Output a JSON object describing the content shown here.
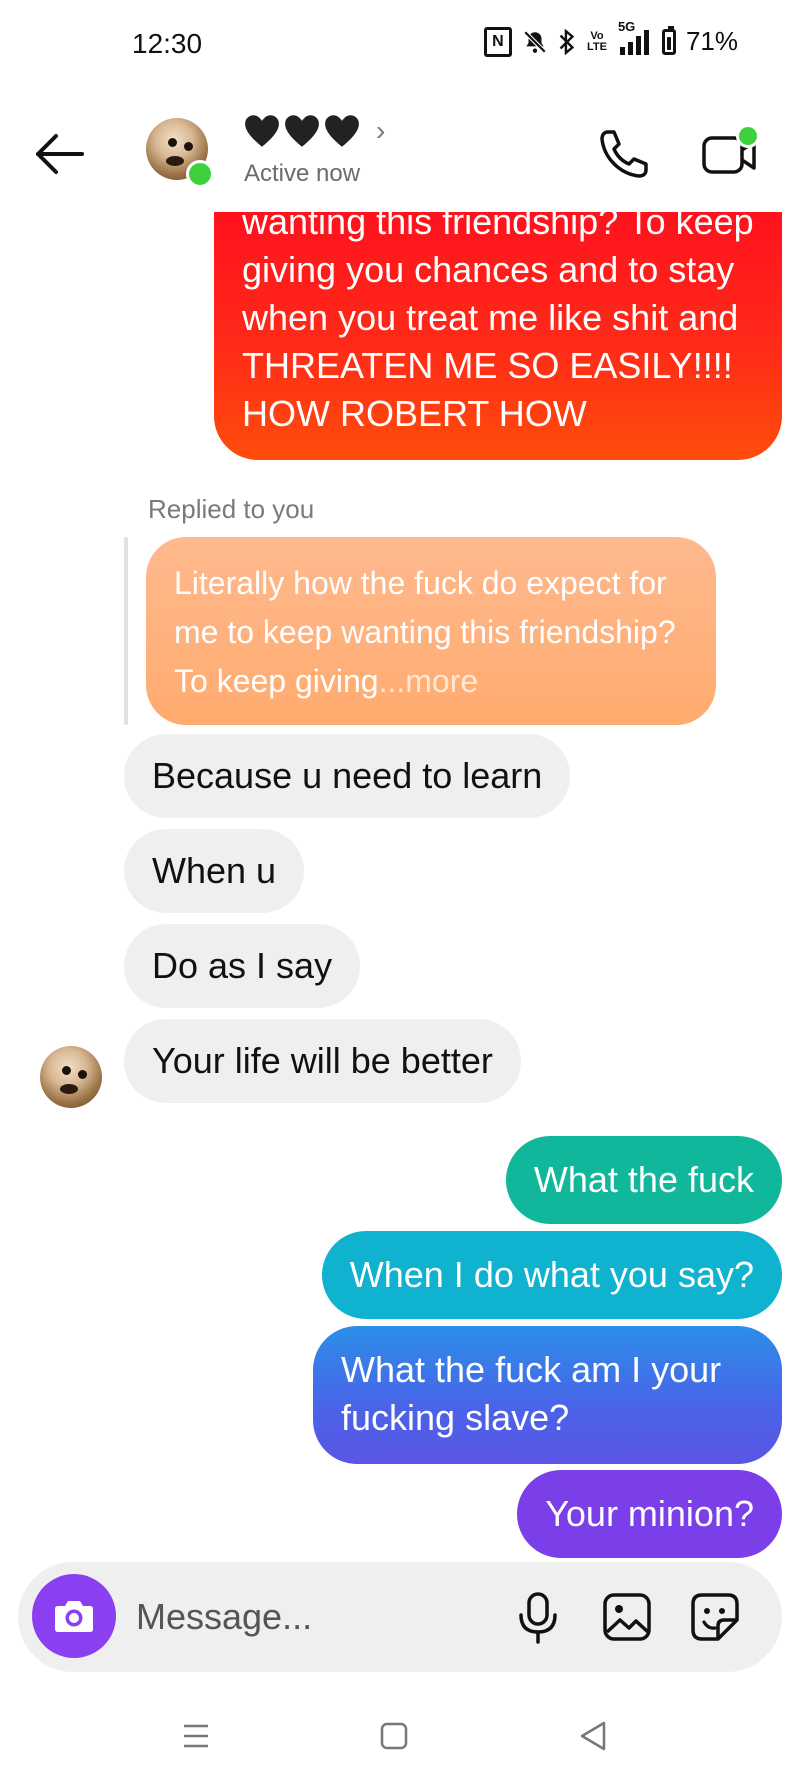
{
  "status_bar": {
    "time": "12:30",
    "nfc_label": "N",
    "volte_label": "Vo LTE",
    "network_label": "5G",
    "battery_percent": "71%",
    "icons": [
      "nfc-icon",
      "mute-notification-icon",
      "bluetooth-icon",
      "volte-icon",
      "signal-icon",
      "battery-icon"
    ]
  },
  "header": {
    "contact_name_hearts": [
      "black-heart-icon",
      "black-heart-icon",
      "black-heart-icon"
    ],
    "chevron": "›",
    "status": "Active now"
  },
  "thread": {
    "top_outgoing_message": "wanting this friendship? To keep giving you chances and to stay when you treat me like shit and THREATEN ME SO EASILY!!!! HOW ROBERT HOW",
    "reply_label": "Replied to you",
    "quoted_message": "Literally how the fuck do expect for me to keep wanting this friendship? To keep giving",
    "quoted_more": "...more",
    "incoming": [
      "Because u need to learn",
      "When u",
      "Do as I say",
      "Your life will be better"
    ],
    "outgoing": [
      "What the fuck",
      "When I do what you say?",
      "What the fuck am I your fucking slave?",
      "Your minion?"
    ]
  },
  "composer": {
    "placeholder": "Message..."
  },
  "colors": {
    "online_green": "#3fd13b",
    "red_bubble": "#ff0a1f",
    "quote_bubble": "#ffb07a",
    "green_bubble": "#10b79a",
    "teal_bubble": "#0fb2cf",
    "blue_bubble": "#3a7ae8",
    "purple_bubble": "#7a3fe8",
    "camera_button": "#8a3ff0",
    "incoming_bubble": "#efefef"
  }
}
